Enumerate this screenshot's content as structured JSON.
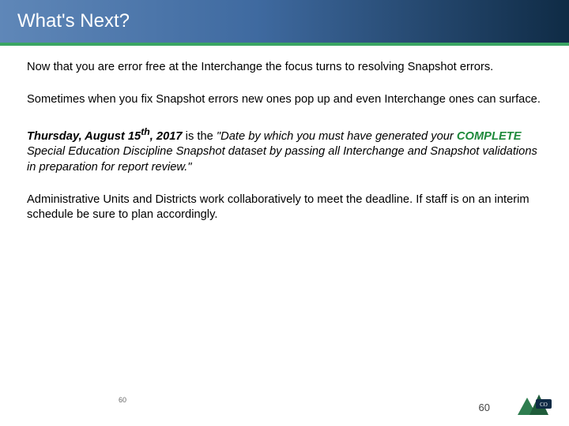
{
  "header": {
    "title": "What's Next?"
  },
  "body": {
    "p1": "Now that you are error free at the Interchange the focus turns to resolving Snapshot errors.",
    "p2": "Sometimes when you fix Snapshot errors new ones pop up and even Interchange ones can surface.",
    "p3_lead": "Thursday, August 15",
    "p3_sup": "th",
    "p3_lead2": ", 2017",
    "p3_mid": " is the ",
    "p3_quote1": "\"Date by which you must have generated your ",
    "p3_complete": "COMPLETE",
    "p3_quote2": " Special Education Discipline Snapshot dataset by passing all Interchange and Snapshot validations in preparation for report review.\"",
    "p4": "Administrative Units and Districts work collaboratively to meet the deadline.  If staff is on an interim schedule be sure to plan accordingly."
  },
  "footer": {
    "small_page": "60",
    "page": "60"
  }
}
